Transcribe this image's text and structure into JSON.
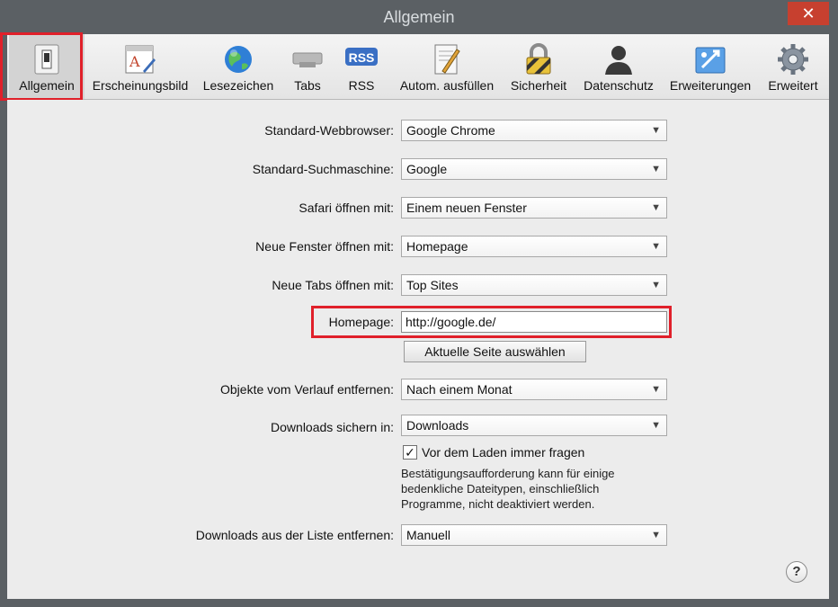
{
  "window": {
    "title": "Allgemein",
    "close_glyph": "✕"
  },
  "toolbar": {
    "items": [
      {
        "label": "Allgemein",
        "icon": "switch-icon",
        "selected": true
      },
      {
        "label": "Erscheinungsbild",
        "icon": "appearance-icon"
      },
      {
        "label": "Lesezeichen",
        "icon": "globe-icon"
      },
      {
        "label": "Tabs",
        "icon": "tabs-icon"
      },
      {
        "label": "RSS",
        "icon": "rss-icon",
        "icon_text": "RSS"
      },
      {
        "label": "Autom. ausfüllen",
        "icon": "autofill-icon"
      },
      {
        "label": "Sicherheit",
        "icon": "lock-icon"
      },
      {
        "label": "Datenschutz",
        "icon": "person-icon"
      },
      {
        "label": "Erweiterungen",
        "icon": "puzzle-icon"
      },
      {
        "label": "Erweitert",
        "icon": "gear-icon"
      }
    ]
  },
  "form": {
    "default_browser": {
      "label": "Standard-Webbrowser:",
      "value": "Google Chrome"
    },
    "search_engine": {
      "label": "Standard-Suchmaschine:",
      "value": "Google"
    },
    "safari_open": {
      "label": "Safari öffnen mit:",
      "value": "Einem neuen Fenster"
    },
    "new_window": {
      "label": "Neue Fenster öffnen mit:",
      "value": "Homepage"
    },
    "new_tabs": {
      "label": "Neue Tabs öffnen mit:",
      "value": "Top Sites"
    },
    "homepage": {
      "label": "Homepage:",
      "value": "http://google.de/"
    },
    "set_current_button": "Aktuelle Seite auswählen",
    "history_remove": {
      "label": "Objekte vom Verlauf entfernen:",
      "value": "Nach einem Monat"
    },
    "downloads_save": {
      "label": "Downloads sichern in:",
      "value": "Downloads"
    },
    "ask_before_download": {
      "label": "Vor dem Laden immer fragen",
      "checked": true
    },
    "note_lines": [
      "Bestätigungsaufforderung kann für einige",
      "bedenkliche Dateitypen, einschließlich",
      "Programme, nicht deaktiviert werden."
    ],
    "downloads_remove": {
      "label": "Downloads aus der Liste entfernen:",
      "value": "Manuell"
    }
  },
  "help": "?",
  "colors": {
    "highlight": "#e0202a",
    "chrome": "#5b6064",
    "pane": "#ececec"
  }
}
